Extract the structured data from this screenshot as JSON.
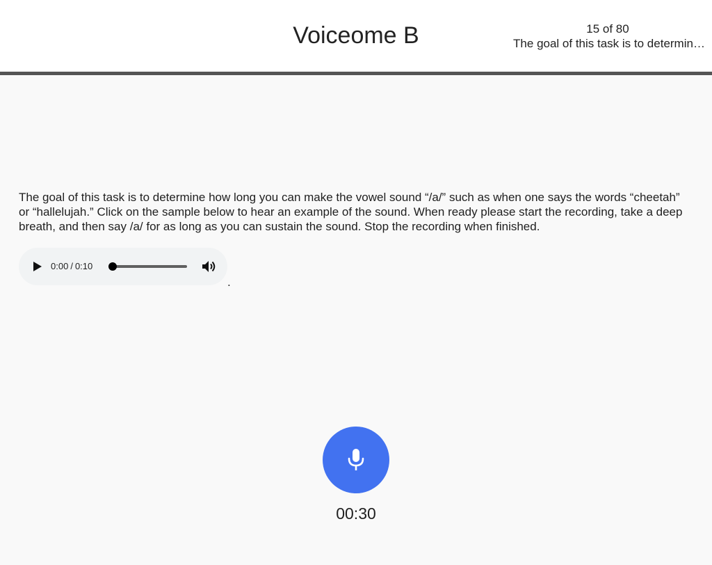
{
  "header": {
    "title": "Voiceome B",
    "progress_count": "15 of 80",
    "progress_step": "The goal of this task is to determin…"
  },
  "task": {
    "instructions": "The goal of this task is to determine how long you can make the vowel sound “/a/” such as when one says the words “cheetah” or “hallelujah.” Click on the sample below to hear an example of the sound. When ready please start the recording, take a deep breath, and then say /a/ for as long as you can sustain the sound. Stop the recording when finished.",
    "trailing_text": "."
  },
  "audio_player": {
    "current_time": "0:00",
    "separator": "/",
    "duration": "0:10",
    "playback_progress": 0,
    "play_icon": "play-icon",
    "volume_icon": "volume-icon"
  },
  "recorder": {
    "mic_icon": "microphone-icon",
    "button_color": "#4272f0",
    "timer": "00:30"
  }
}
